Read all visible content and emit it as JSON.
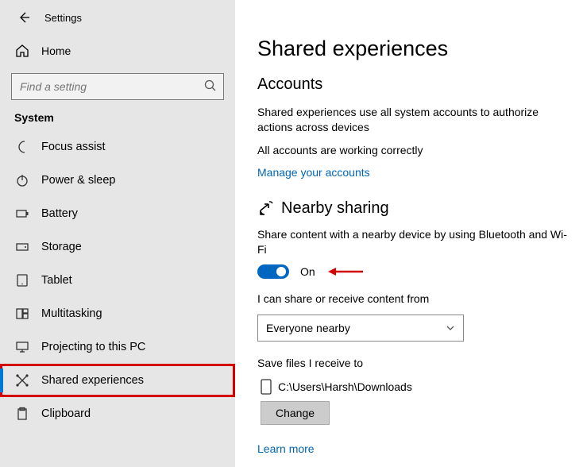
{
  "app_title": "Settings",
  "home_label": "Home",
  "search": {
    "placeholder": "Find a setting"
  },
  "category_heading": "System",
  "sidebar": {
    "items": [
      {
        "label": "Focus assist"
      },
      {
        "label": "Power & sleep"
      },
      {
        "label": "Battery"
      },
      {
        "label": "Storage"
      },
      {
        "label": "Tablet"
      },
      {
        "label": "Multitasking"
      },
      {
        "label": "Projecting to this PC"
      },
      {
        "label": "Shared experiences"
      },
      {
        "label": "Clipboard"
      }
    ]
  },
  "main": {
    "page_title": "Shared experiences",
    "accounts": {
      "heading": "Accounts",
      "body": "Shared experiences use all system accounts to authorize actions across devices",
      "status": "All accounts are working correctly",
      "manage_link": "Manage your accounts"
    },
    "nearby": {
      "heading": "Nearby sharing",
      "body": "Share content with a nearby device by using Bluetooth and Wi-Fi",
      "toggle_state": "On",
      "share_from_label": "I can share or receive content from",
      "share_from_value": "Everyone nearby",
      "save_to_label": "Save files I receive to",
      "save_to_path": "C:\\Users\\Harsh\\Downloads",
      "change_button": "Change",
      "learn_more": "Learn more"
    }
  }
}
